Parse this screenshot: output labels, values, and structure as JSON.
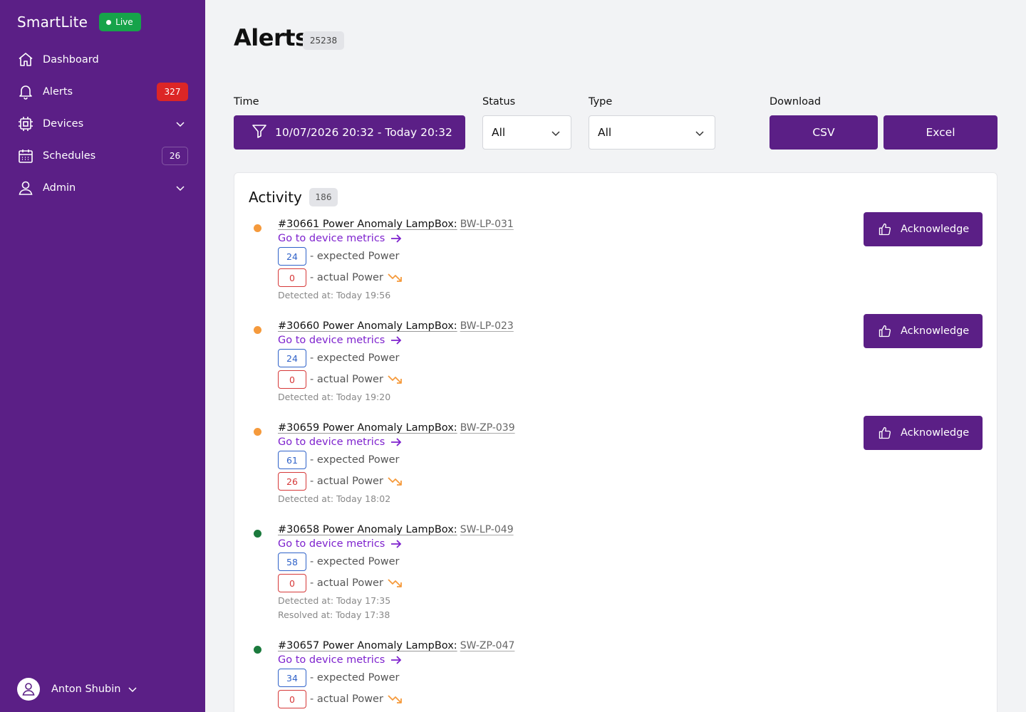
{
  "brand": {
    "name": "SmartLite",
    "status": "Live"
  },
  "nav": {
    "items": [
      {
        "label": "Dashboard",
        "icon": "home-icon",
        "badge": ""
      },
      {
        "label": "Alerts",
        "icon": "bell-icon",
        "badge": "327"
      },
      {
        "label": "Devices",
        "icon": "chip-icon",
        "badge": ""
      },
      {
        "label": "Schedules",
        "icon": "calendar-icon",
        "badge": "26"
      },
      {
        "label": "Admin",
        "icon": "user-icon",
        "badge": ""
      }
    ]
  },
  "user": {
    "name": "Anton Shubin"
  },
  "page": {
    "title": "Alerts",
    "count": "25238"
  },
  "filters": {
    "time_label": "Time",
    "time_value": "10/07/2026 20:32 - Today 20:32",
    "status_label": "Status",
    "status_value": "All",
    "type_label": "Type",
    "type_value": "All",
    "download_label": "Download",
    "csv_label": "CSV",
    "excel_label": "Excel"
  },
  "activity": {
    "title": "Activity",
    "count": "186",
    "link_label": "Go to device metrics",
    "expected_label": "- expected Power",
    "actual_label": "- actual Power",
    "ack_label": "Acknowledge",
    "alerts": [
      {
        "title": "#30661 Power Anomaly LampBox:",
        "device": "BW-LP-031",
        "expected": "24",
        "actual": "0",
        "detected": "Detected at: Today 19:56",
        "resolved": "",
        "status_color": "#f59a3c",
        "ack": true
      },
      {
        "title": "#30660 Power Anomaly LampBox:",
        "device": "BW-LP-023",
        "expected": "24",
        "actual": "0",
        "detected": "Detected at: Today 19:20",
        "resolved": "",
        "status_color": "#f59a3c",
        "ack": true
      },
      {
        "title": "#30659 Power Anomaly LampBox:",
        "device": "BW-ZP-039",
        "expected": "61",
        "actual": "26",
        "detected": "Detected at: Today 18:02",
        "resolved": "",
        "status_color": "#f59a3c",
        "ack": true
      },
      {
        "title": "#30658 Power Anomaly LampBox:",
        "device": "SW-LP-049",
        "expected": "58",
        "actual": "0",
        "detected": "Detected at: Today 17:35",
        "resolved": "Resolved at: Today 17:38",
        "status_color": "#1b7a3d",
        "ack": false
      },
      {
        "title": "#30657 Power Anomaly LampBox:",
        "device": "SW-ZP-047",
        "expected": "34",
        "actual": "0",
        "detected": "",
        "resolved": "",
        "status_color": "#1b7a3d",
        "ack": false
      }
    ]
  }
}
